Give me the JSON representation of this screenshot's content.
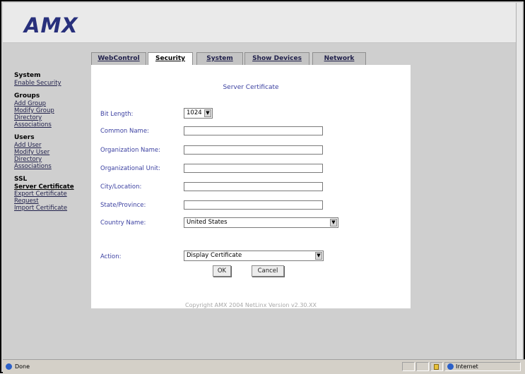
{
  "logo": "AMX",
  "sidebar": {
    "groups": [
      {
        "title": "System",
        "links": [
          "Enable Security"
        ]
      },
      {
        "title": "Groups",
        "links": [
          "Add Group",
          "Modify Group",
          "Directory",
          "Associations"
        ]
      },
      {
        "title": "Users",
        "links": [
          "Add User",
          "Modify User",
          "Directory",
          "Associations"
        ]
      },
      {
        "title": "SSL",
        "links": [
          "Server Certificate",
          "Export Certificate",
          "Request",
          "Import Certificate"
        ]
      }
    ]
  },
  "tabs": [
    "WebControl",
    "Security",
    "System",
    "Show Devices",
    "Network"
  ],
  "active_tab": "Security",
  "panel": {
    "title": "Server Certificate",
    "bit_length": {
      "label": "Bit Length:",
      "value": "1024"
    },
    "common_name": {
      "label": "Common Name:",
      "value": ""
    },
    "organization_name": {
      "label": "Organization Name:",
      "value": ""
    },
    "organizational_unit": {
      "label": "Organizational Unit:",
      "value": ""
    },
    "city": {
      "label": "City/Location:",
      "value": ""
    },
    "state": {
      "label": "State/Province:",
      "value": ""
    },
    "country": {
      "label": "Country Name:",
      "value": "United States"
    },
    "action": {
      "label": "Action:",
      "value": "Display Certificate"
    },
    "ok_label": "OK",
    "cancel_label": "Cancel",
    "copyright": "Copyright AMX 2004   NetLinx Version v2.30.XX"
  },
  "status": {
    "left_text": "Done",
    "zone": "Internet"
  },
  "colors": {
    "logo": "#28307c",
    "label": "#3a3fa0",
    "background": "#cfcfcf"
  }
}
